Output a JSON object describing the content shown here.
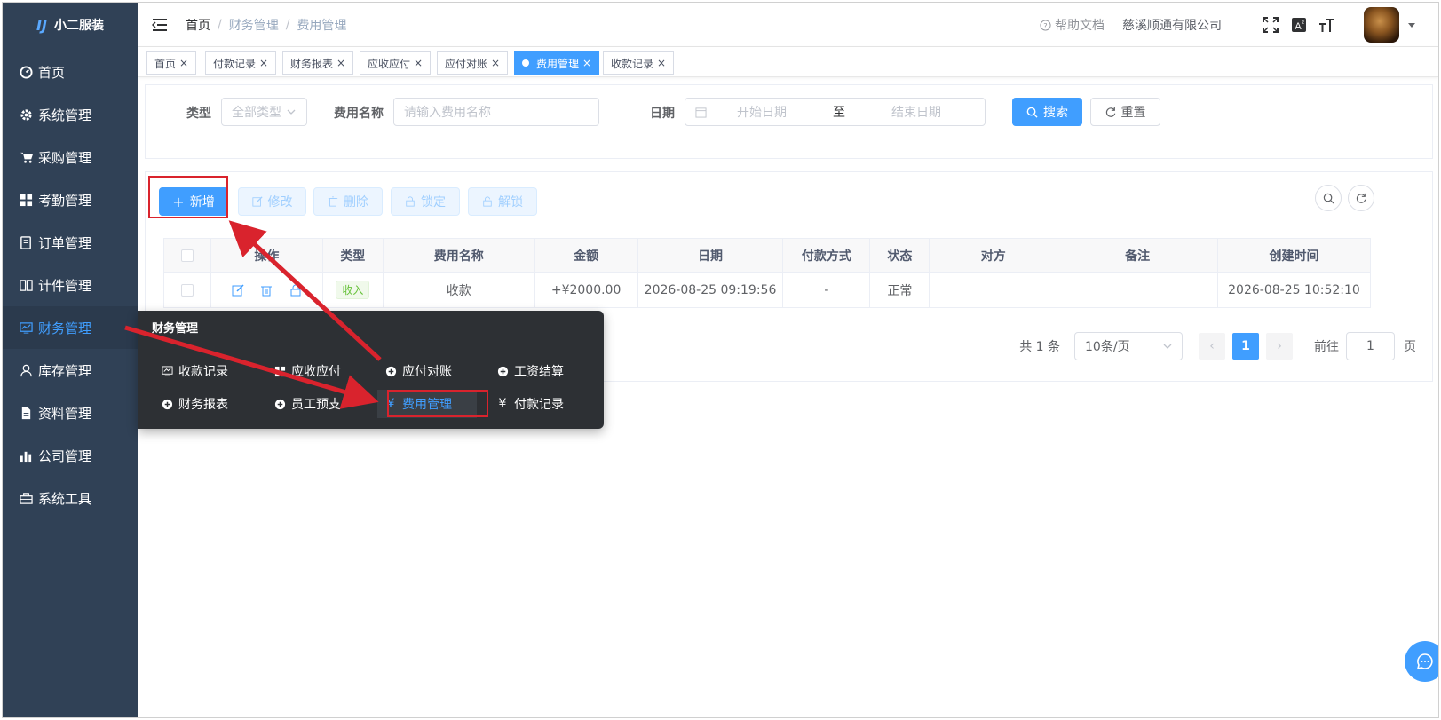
{
  "app": {
    "name": "小二服装",
    "logo_mark": "IJ"
  },
  "sidebar": {
    "items": [
      {
        "label": "首页",
        "icon": "dashboard-icon"
      },
      {
        "label": "系统管理",
        "icon": "gear-icon"
      },
      {
        "label": "采购管理",
        "icon": "cart-icon"
      },
      {
        "label": "考勤管理",
        "icon": "grid-icon"
      },
      {
        "label": "订单管理",
        "icon": "order-icon"
      },
      {
        "label": "计件管理",
        "icon": "book-icon"
      },
      {
        "label": "财务管理",
        "icon": "chart-icon",
        "active": true
      },
      {
        "label": "库存管理",
        "icon": "user-icon"
      },
      {
        "label": "资料管理",
        "icon": "document-icon"
      },
      {
        "label": "公司管理",
        "icon": "bar-chart-icon"
      },
      {
        "label": "系统工具",
        "icon": "toolbox-icon"
      }
    ]
  },
  "header": {
    "breadcrumb": [
      "首页",
      "财务管理",
      "费用管理"
    ],
    "breadcrumb_sep": "/",
    "help": "帮助文档",
    "company": "慈溪顺通有限公司"
  },
  "tags": [
    {
      "label": "首页"
    },
    {
      "label": "付款记录"
    },
    {
      "label": "财务报表"
    },
    {
      "label": "应收应付"
    },
    {
      "label": "应付对账"
    },
    {
      "label": "费用管理",
      "active": true
    },
    {
      "label": "收款记录"
    }
  ],
  "tag_close": "×",
  "search": {
    "type_label": "类型",
    "type_placeholder": "全部类型",
    "name_label": "费用名称",
    "name_placeholder": "请输入费用名称",
    "date_label": "日期",
    "start_placeholder": "开始日期",
    "range_sep": "至",
    "end_placeholder": "结束日期",
    "search_btn": "搜索",
    "reset_btn": "重置"
  },
  "toolbar": {
    "add": "新增",
    "edit": "修改",
    "delete": "删除",
    "lock": "锁定",
    "unlock": "解锁"
  },
  "table": {
    "columns": [
      "操作",
      "类型",
      "费用名称",
      "金额",
      "日期",
      "付款方式",
      "状态",
      "对方",
      "备注",
      "创建时间"
    ],
    "rows": [
      {
        "type": "收入",
        "name": "收款",
        "amount": "+¥2000.00",
        "date": "2026-08-25 09:19:56",
        "pay_method": "-",
        "status": "正常",
        "counterparty": "",
        "remark": "",
        "created": "2026-08-25 10:52:10"
      }
    ]
  },
  "pagination": {
    "total": "共 1 条",
    "page_size": "10条/页",
    "current": "1",
    "goto_label": "前往",
    "goto_value": "1",
    "page_unit": "页",
    "prev": "‹",
    "next": "›"
  },
  "submenu": {
    "title": "财务管理",
    "items": [
      {
        "label": "收款记录",
        "icon": "chart-icon"
      },
      {
        "label": "应收应付",
        "icon": "grid-icon"
      },
      {
        "label": "应付对账",
        "icon": "plus-circle-icon"
      },
      {
        "label": "工资结算",
        "icon": "plus-circle-icon"
      },
      {
        "label": "财务报表",
        "icon": "plus-circle-icon"
      },
      {
        "label": "员工预支",
        "icon": "plus-circle-icon"
      },
      {
        "label": "费用管理",
        "icon": "yen-icon",
        "selected": true
      },
      {
        "label": "付款记录",
        "icon": "yen-icon"
      }
    ]
  },
  "colors": {
    "sidebar_bg": "#304156",
    "accent": "#409eff",
    "annotation": "#d9232d",
    "popup_bg": "#2d3034"
  }
}
